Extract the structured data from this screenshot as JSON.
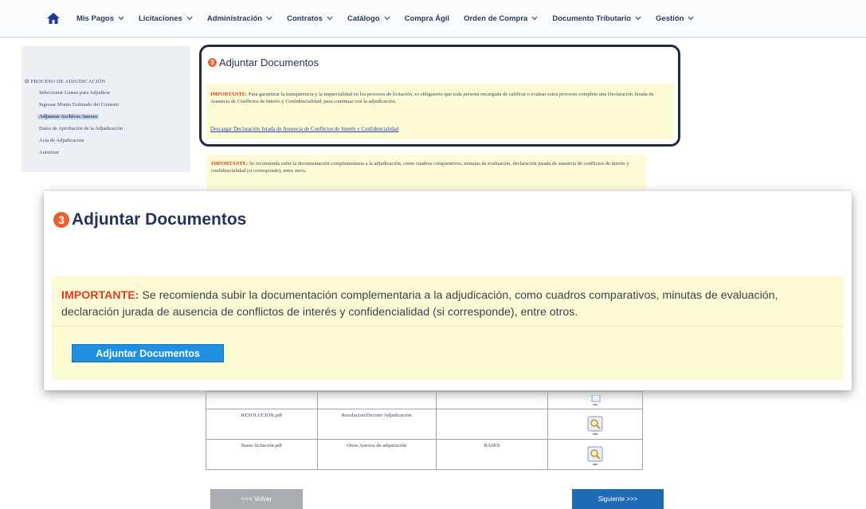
{
  "nav": {
    "items": [
      {
        "label": "Mis Pagos",
        "dropdown": true
      },
      {
        "label": "Licitaciones",
        "dropdown": true
      },
      {
        "label": "Administración",
        "dropdown": true
      },
      {
        "label": "Contratos",
        "dropdown": true
      },
      {
        "label": "Catálogo",
        "dropdown": true
      },
      {
        "label": "Compra Ágil",
        "dropdown": false
      },
      {
        "label": "Orden de Compra",
        "dropdown": true
      },
      {
        "label": "Documento Tributario",
        "dropdown": true
      },
      {
        "label": "Gestión",
        "dropdown": true
      }
    ]
  },
  "sidebar": {
    "title": "⊟ PROCESO DE ADJUDICACIÓN",
    "items": [
      {
        "label": "Seleccionar Líneas para Adjudicar"
      },
      {
        "label": "Ingresar Monto Estimado del Contrato"
      },
      {
        "label": "Adjuntar Archivos Anexos"
      },
      {
        "label": "Datos de Aprobación de la Adjudicación"
      },
      {
        "label": "Acta de Adjudicación"
      },
      {
        "label": "Autorizar"
      }
    ]
  },
  "upper": {
    "step_number": "3",
    "title": "Adjuntar Documentos",
    "warning_label": "IMPORTANTE:",
    "warning_text": " Para garantizar la transparencia y la imparcialidad en los procesos de licitación, es obligatorio que toda persona encargada de calificar o evaluar estos procesos complete una Declaración Jurada de Ausencia de Conflictos de Interés y Confidencialidad, para continuar con la adjudicación.",
    "link_text": "Descargar Declaración Jurada de Ausencia de Conflictos de Interés y Confidencialidad"
  },
  "middle": {
    "warning_label": "IMPORTANTE:",
    "warning_text": " Se recomienda subir la documentación complementaria a la adjudicación, como cuadros comparativos, minutas de evaluación, declaración jurada de ausencia de conflictos de interés y confidencialidad (si corresponde), entre otros."
  },
  "overlay": {
    "step_number": "3",
    "title": "Adjuntar Documentos",
    "warning_label": "IMPORTANTE:",
    "warning_text": " Se recomienda subir la documentación complementaria a la adjudicación, como cuadros comparativos, minutas de evaluación, declaración jurada de ausencia de conflictos de interés y confidencialidad (si corresponde), entre otros.",
    "button_label": "Adjuntar Documentos"
  },
  "table": {
    "rows": [
      {
        "file": "",
        "type": "",
        "tag": ""
      },
      {
        "file": "RESOLUCIÓN.pdf",
        "type": "Resolución/Decreto Adjudicación",
        "tag": ""
      },
      {
        "file": "Bases licitación.pdf",
        "type": "Otros Anexos de adquisición",
        "tag": "BASES"
      }
    ]
  },
  "footer": {
    "back_label": "<<< Volver",
    "next_label": "Siguiente >>>"
  },
  "colors": {
    "accent_orange": "#e8622c",
    "important_red": "#e03b22",
    "warning_bg": "#fdfbd6",
    "primary_blue": "#1e8fe1",
    "next_blue": "#1f6bb5",
    "back_gray": "#a9acb1"
  }
}
